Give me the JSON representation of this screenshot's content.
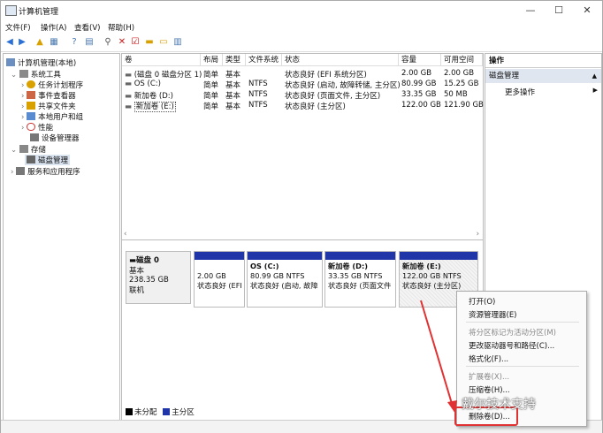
{
  "window": {
    "title": "计算机管理",
    "min": "—",
    "max": "☐",
    "close": "✕"
  },
  "menu": [
    "文件(F)",
    "操作(A)",
    "查看(V)",
    "帮助(H)"
  ],
  "tree": {
    "root": "计算机管理(本地)",
    "system_tools": "系统工具",
    "task_scheduler": "任务计划程序",
    "event_viewer": "事件查看器",
    "shared_folders": "共享文件夹",
    "local_users": "本地用户和组",
    "performance": "性能",
    "device_manager": "设备管理器",
    "storage": "存储",
    "disk_management": "磁盘管理",
    "services": "服务和应用程序"
  },
  "columns": [
    "卷",
    "布局",
    "类型",
    "文件系统",
    "状态",
    "容量",
    "可用空间"
  ],
  "volumes": [
    {
      "name": "(磁盘 0 磁盘分区 1)",
      "layout": "简单",
      "type": "基本",
      "fs": "",
      "status": "状态良好 (EFI 系统分区)",
      "cap": "2.00 GB",
      "free": "2.00 GB"
    },
    {
      "name": "OS (C:)",
      "layout": "简单",
      "type": "基本",
      "fs": "NTFS",
      "status": "状态良好 (启动, 故障转储, 主分区)",
      "cap": "80.99 GB",
      "free": "15.25 GB"
    },
    {
      "name": "新加卷 (D:)",
      "layout": "简单",
      "type": "基本",
      "fs": "NTFS",
      "status": "状态良好 (页面文件, 主分区)",
      "cap": "33.35 GB",
      "free": "50 MB"
    },
    {
      "name": "新加卷 (E:)",
      "layout": "简单",
      "type": "基本",
      "fs": "NTFS",
      "status": "状态良好 (主分区)",
      "cap": "122.00 GB",
      "free": "121.90 GB"
    }
  ],
  "disk": {
    "name": "磁盘 0",
    "type": "基本",
    "size": "238.35 GB",
    "state": "联机"
  },
  "partitions": [
    {
      "title": "",
      "l1": "2.00 GB",
      "l2": "状态良好 (EFI"
    },
    {
      "title": "OS  (C:)",
      "l1": "80.99 GB NTFS",
      "l2": "状态良好 (启动, 故障"
    },
    {
      "title": "新加卷  (D:)",
      "l1": "33.35 GB NTFS",
      "l2": "状态良好 (页面文件"
    },
    {
      "title": "新加卷  (E:)",
      "l1": "122.00 GB NTFS",
      "l2": "状态良好 (主分区)"
    }
  ],
  "legend": {
    "unallocated": "未分配",
    "primary": "主分区"
  },
  "actions": {
    "header": "操作",
    "selected": "磁盘管理",
    "more": "更多操作"
  },
  "context_menu": {
    "open": "打开(O)",
    "explorer": "资源管理器(E)",
    "mark_active": "将分区标记为活动分区(M)",
    "change_letter": "更改驱动器号和路径(C)...",
    "format": "格式化(F)...",
    "extend": "扩展卷(X)...",
    "shrink": "压缩卷(H)...",
    "delete": "删除卷(D)..."
  },
  "watermark": "戴尔技术支持",
  "colors": {
    "primary_partition": "#1f35a8",
    "highlight": "#e03232",
    "unallocated": "#000000"
  }
}
